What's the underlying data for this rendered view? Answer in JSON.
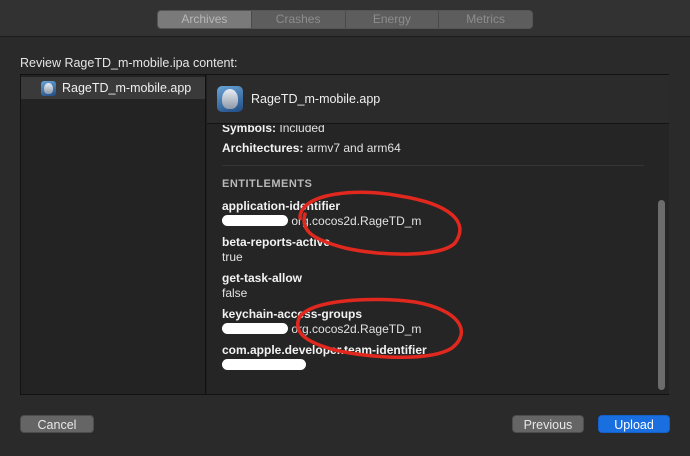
{
  "tabs": [
    {
      "label": "Archives",
      "active": true
    },
    {
      "label": "Crashes",
      "active": false
    },
    {
      "label": "Energy",
      "active": false
    },
    {
      "label": "Metrics",
      "active": false
    }
  ],
  "review_title": "Review RageTD_m-mobile.ipa content:",
  "sidebar": {
    "items": [
      {
        "label": "RageTD_m-mobile.app",
        "icon": "app-icon"
      }
    ]
  },
  "content": {
    "header_title": "RageTD_m-mobile.app",
    "symbols_key": "Symbols:",
    "symbols_value": "Included",
    "architectures_key": "Architectures:",
    "architectures_value": "armv7 and arm64",
    "entitlements_heading": "ENTITLEMENTS",
    "entitlements": [
      {
        "key": "application-identifier",
        "value": "org.cocos2d.RageTD_m",
        "redacted_prefix": true
      },
      {
        "key": "beta-reports-active",
        "value": "true",
        "redacted_prefix": false
      },
      {
        "key": "get-task-allow",
        "value": "false",
        "redacted_prefix": false
      },
      {
        "key": "keychain-access-groups",
        "value": "org.cocos2d.RageTD_m",
        "redacted_prefix": true
      },
      {
        "key": "com.apple.developer.team-identifier",
        "value": "",
        "redacted_prefix": true
      }
    ]
  },
  "buttons": {
    "cancel": "Cancel",
    "previous": "Previous",
    "upload": "Upload"
  },
  "colors": {
    "upload_accent": "#1a6fe0",
    "annotation_red": "#e0281e"
  }
}
